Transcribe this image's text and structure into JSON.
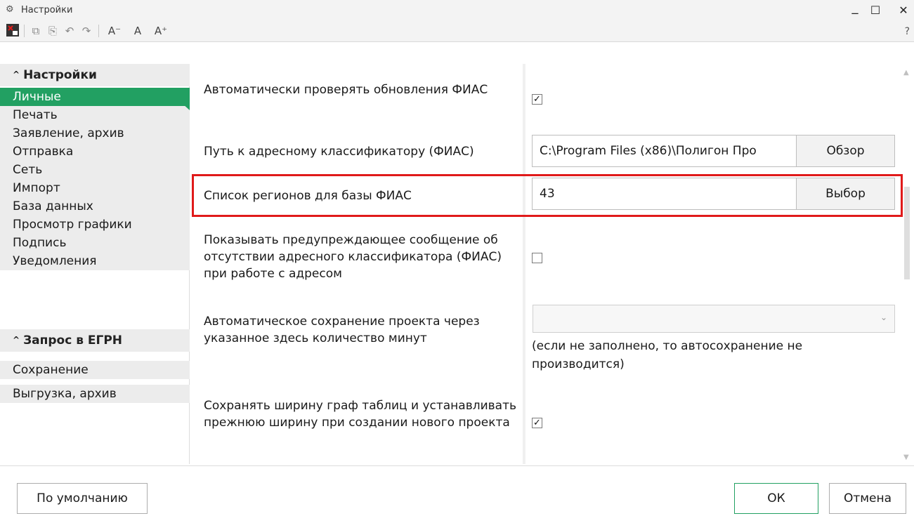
{
  "window": {
    "title": "Настройки",
    "minimize_glyph": "_",
    "maximize_glyph": "☐",
    "close_glyph": "✕"
  },
  "toolbar": {
    "font_decrease_label": "A⁻",
    "font_normal_label": "A",
    "font_increase_label": "A⁺",
    "help_label": "?"
  },
  "sidebar": {
    "groups": [
      {
        "label": "Настройки",
        "items": [
          "Личные",
          "Печать",
          "Заявление, архив",
          "Отправка",
          "Сеть",
          "Импорт",
          "База данных",
          "Просмотр графики",
          "Подпись",
          "Уведомления"
        ]
      },
      {
        "label": "Запрос в ЕГРН",
        "items": [
          "Сохранение",
          "Выгрузка, архив"
        ]
      }
    ],
    "active_item": "Личные"
  },
  "settings": {
    "auto_check_fias": {
      "label": "Автоматически проверять обновления ФИАС",
      "checked": true
    },
    "fias_path": {
      "label": "Путь к адресному классификатору (ФИАС)",
      "value": "C:\\Program Files (x86)\\Полигон Про",
      "button": "Обзор"
    },
    "regions_list": {
      "label": "Список регионов для базы ФИАС",
      "value": "43",
      "button": "Выбор"
    },
    "warn_no_fias": {
      "label": "Показывать предупреждающее сообщение об отсутствии адресного классификатора (ФИАС) при работе с адресом",
      "checked": false
    },
    "autosave": {
      "label": "Автоматическое сохранение проекта через указанное здесь количество минут",
      "value": "",
      "note": "(если не заполнено, то автосохранение не производится)"
    },
    "keep_column_width": {
      "label": "Сохранять ширину граф таблиц и устанавливать прежнюю ширину при создании нового проекта",
      "checked": true
    }
  },
  "footer": {
    "defaults_label": "По умолчанию",
    "ok_label": "ОК",
    "cancel_label": "Отмена"
  },
  "colors": {
    "accent": "#22a062",
    "highlight": "#e01a1a"
  }
}
